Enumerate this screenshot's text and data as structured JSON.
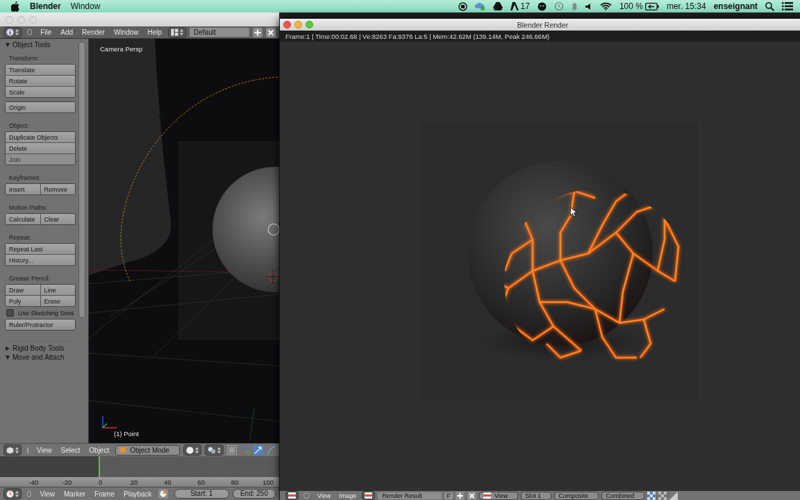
{
  "menubar": {
    "app": "Blender",
    "menus": [
      "Window"
    ],
    "badge_count": "17",
    "battery": "100 %",
    "clock": "mer. 15:34",
    "user": "enseignant"
  },
  "blender_window": {
    "header_menus": [
      "File",
      "Add",
      "Render",
      "Window",
      "Help"
    ],
    "layout": "Default",
    "tool_panel": {
      "title": "Object Tools",
      "expanded": true,
      "sections": [
        {
          "label": "Transform:",
          "items": [
            {
              "kind": "group",
              "rows": [
                [
                  {
                    "label": "Translate",
                    "disabled": false
                  }
                ],
                [
                  {
                    "label": "Rotate",
                    "disabled": false
                  }
                ],
                [
                  {
                    "label": "Scale",
                    "disabled": false
                  }
                ]
              ]
            },
            {
              "kind": "group",
              "rows": [
                [
                  {
                    "label": "Origin",
                    "disabled": false
                  }
                ]
              ]
            }
          ]
        },
        {
          "label": "Object:",
          "items": [
            {
              "kind": "group",
              "rows": [
                [
                  {
                    "label": "Duplicate Objects",
                    "disabled": false
                  }
                ],
                [
                  {
                    "label": "Delete",
                    "disabled": false
                  }
                ],
                [
                  {
                    "label": "Join",
                    "disabled": true
                  }
                ]
              ]
            }
          ]
        },
        {
          "label": "Keyframes:",
          "items": [
            {
              "kind": "group",
              "rows": [
                [
                  {
                    "label": "Insert",
                    "disabled": false
                  },
                  {
                    "label": "Remove",
                    "disabled": false
                  }
                ]
              ]
            }
          ]
        },
        {
          "label": "Motion Paths:",
          "items": [
            {
              "kind": "group",
              "rows": [
                [
                  {
                    "label": "Calculate",
                    "disabled": false
                  },
                  {
                    "label": "Clear",
                    "disabled": false
                  }
                ]
              ]
            }
          ]
        },
        {
          "label": "Repeat:",
          "items": [
            {
              "kind": "group",
              "rows": [
                [
                  {
                    "label": "Repeat Last",
                    "disabled": false
                  }
                ],
                [
                  {
                    "label": "History...",
                    "disabled": false
                  }
                ]
              ]
            }
          ]
        },
        {
          "label": "Grease Pencil:",
          "items": [
            {
              "kind": "group",
              "rows": [
                [
                  {
                    "label": "Draw",
                    "disabled": false
                  },
                  {
                    "label": "Line",
                    "disabled": false
                  }
                ],
                [
                  {
                    "label": "Poly",
                    "disabled": false
                  },
                  {
                    "label": "Erase",
                    "disabled": false
                  }
                ]
              ]
            },
            {
              "kind": "checkbox",
              "label": "Use Sketching Sess",
              "checked": false
            },
            {
              "kind": "group",
              "rows": [
                [
                  {
                    "label": "Ruler/Protractor",
                    "disabled": false
                  }
                ]
              ]
            }
          ]
        }
      ],
      "more_panels": [
        {
          "title": "Rigid Body Tools",
          "expanded": false
        },
        {
          "title": "Move and Attach",
          "expanded": true
        }
      ]
    },
    "viewport": {
      "view_label": "Camera Persp",
      "object_label": "(1) Point"
    },
    "viewport_header": {
      "menus": [
        "View",
        "Select",
        "Object"
      ],
      "mode": "Object Mode"
    },
    "timeline": {
      "ticks": [
        "-40",
        "-20",
        "0",
        "20",
        "40",
        "60",
        "80",
        "100"
      ]
    },
    "timeline_header": {
      "menus": [
        "View",
        "Marker",
        "Frame",
        "Playback"
      ],
      "start": "Start: 1",
      "end": "End: 250"
    }
  },
  "render_window": {
    "title": "Blender Render",
    "info": "Frame:1 | Time:00:02.68 | Ve:8263 Fa:9376 La:5 | Mem:42.62M (139.14M, Peak 246.66M)",
    "header": {
      "menus": [
        "View",
        "Image"
      ],
      "image": "Render Result",
      "fake_user": "F",
      "view": "View",
      "slot": "Slot 1",
      "layer": "Composite",
      "pass": "Combined"
    }
  }
}
